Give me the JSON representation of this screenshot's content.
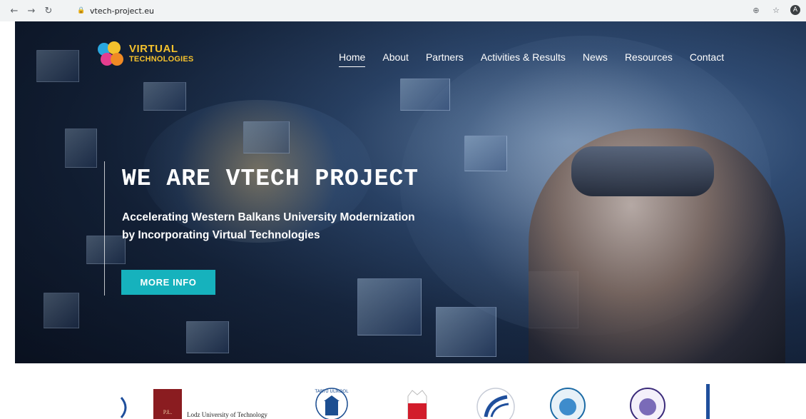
{
  "browser": {
    "url": "vtech-project.eu",
    "back_icon": "arrow-left-icon",
    "forward_icon": "arrow-right-icon",
    "reload_icon": "reload-icon",
    "avatar_letter": "A"
  },
  "site": {
    "logo": {
      "line1": "VIRTUAL",
      "line2": "TECHNOLOGIES"
    },
    "nav": [
      {
        "label": "Home",
        "active": true
      },
      {
        "label": "About"
      },
      {
        "label": "Partners"
      },
      {
        "label": "Activities & Results"
      },
      {
        "label": "News"
      },
      {
        "label": "Resources"
      },
      {
        "label": "Contact"
      }
    ],
    "hero": {
      "title": "WE ARE VTECH PROJECT",
      "subtitle_line1": "Accelerating Western Balkans University Modernization",
      "subtitle_line2": "by Incorporating Virtual Technologies",
      "button": "MORE INFO"
    },
    "partners": {
      "lodz": "Lodz University of Technology",
      "tartu_text": "TARTU ÜLIKOOL"
    }
  },
  "colors": {
    "accent": "#16b2bd",
    "logo_yellow": "#f4c12d"
  }
}
